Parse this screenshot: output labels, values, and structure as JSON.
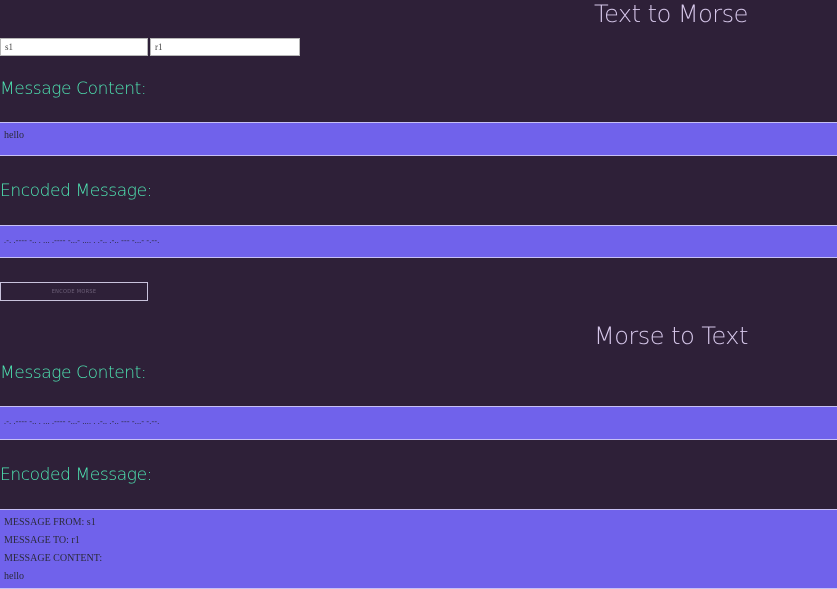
{
  "text_to_morse": {
    "title": "Text to Morse",
    "from_value": "s1",
    "to_value": "r1",
    "content_label": "Message Content:",
    "content_text": "hello",
    "encoded_label": "Encoded Message:",
    "encoded_text": ".-. .---- -.. . ... .---- -...- .... . .-.. .-.. --- -...- -.--.",
    "button_label": "ENCODE MORSE"
  },
  "morse_to_text": {
    "title": "Morse to Text",
    "content_label": "Message Content:",
    "content_text": ".-. .---- -.. . ... .---- -...- .... . .-.. .-.. --- -...- -.--.",
    "decoded_label": "Encoded Message:",
    "decoded_lines": {
      "from": "MESSAGE FROM: s1",
      "to": "MESSAGE TO: r1",
      "content_heading": "MESSAGE CONTENT:",
      "content": "hello"
    }
  },
  "colors": {
    "background": "#2e2038",
    "accent_label": "#4fe8b4",
    "panel": "#7062eb",
    "title": "#d6c7ea"
  }
}
